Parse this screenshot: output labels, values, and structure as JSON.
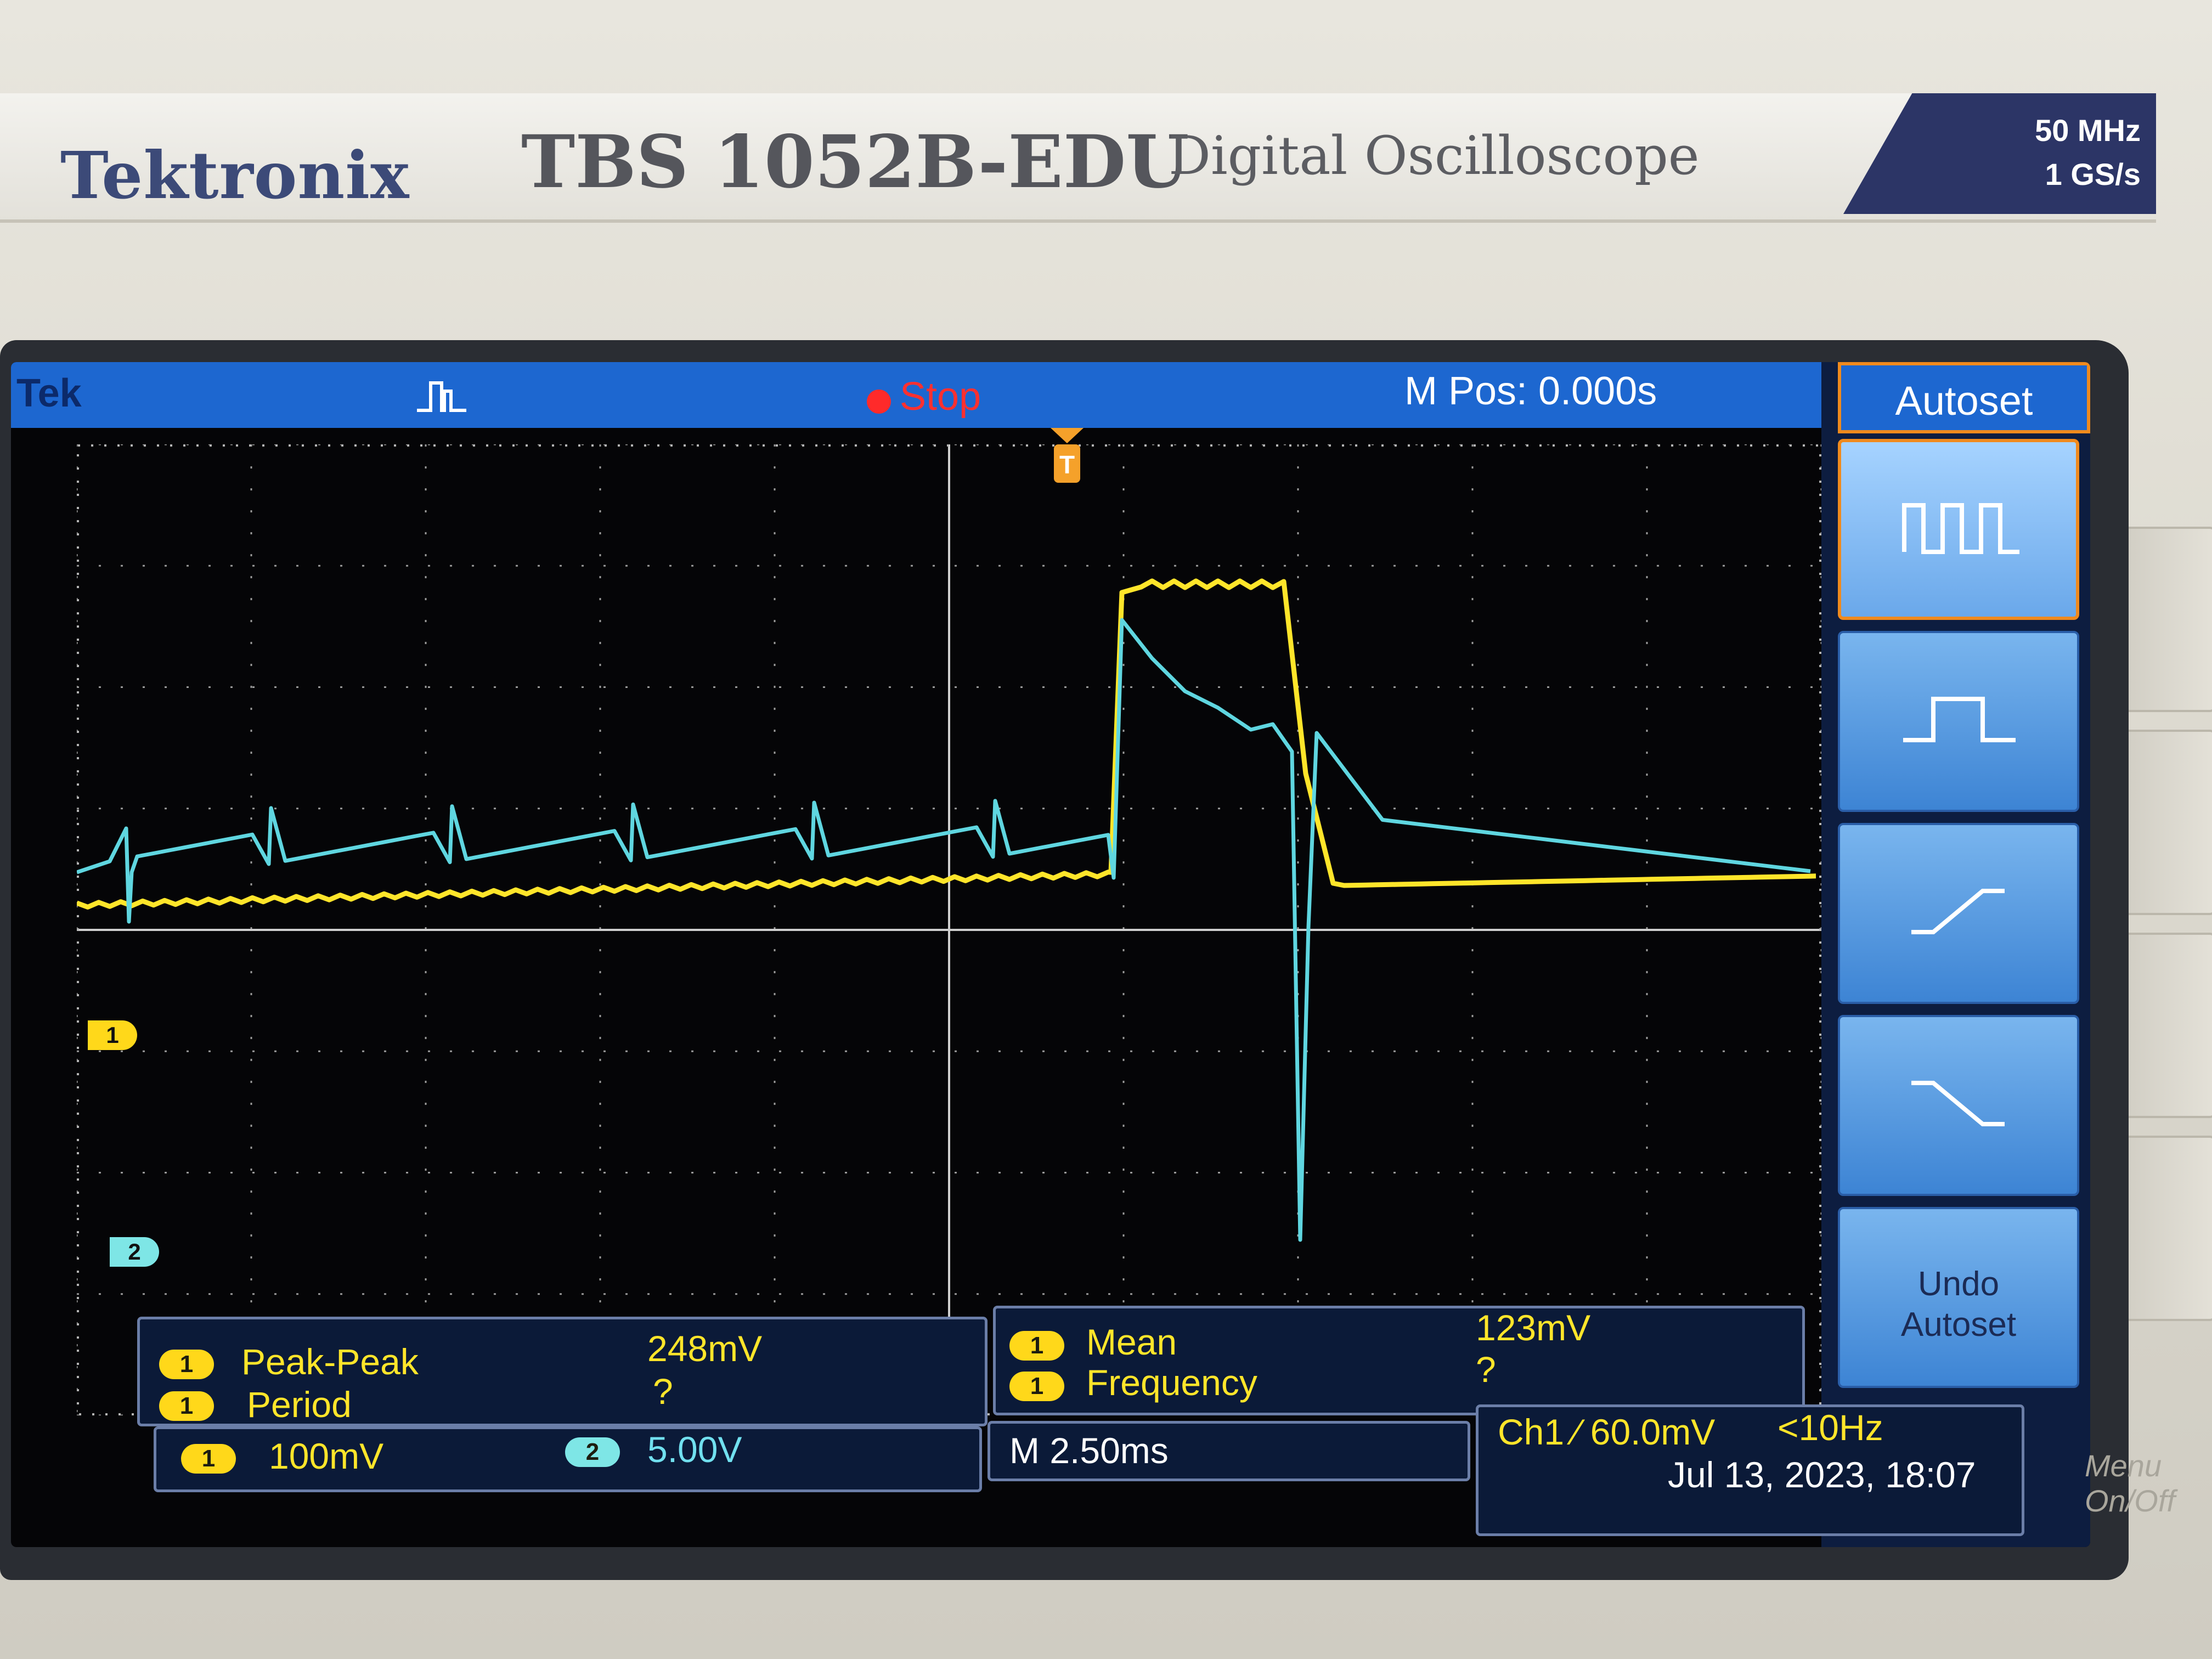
{
  "device": {
    "brand": "Tektronix",
    "model": "TBS 1052B-EDU",
    "subtitle": "Digital Oscilloscope",
    "spec_bandwidth": "50 MHz",
    "spec_sample_rate": "1 GS/s"
  },
  "topbar": {
    "tek": "Tek",
    "status": "Stop",
    "mpos": "M Pos: 0.000s"
  },
  "trigger_marker": "T",
  "channel_markers": {
    "ch1": "1",
    "ch2": "2"
  },
  "menu": {
    "title": "Autoset",
    "undo_line1": "Undo",
    "undo_line2": "Autoset"
  },
  "measurements": {
    "m1": {
      "ch": "1",
      "label": "Peak-Peak",
      "value": "248mV"
    },
    "m2": {
      "ch": "1",
      "label": "Period",
      "value": "?"
    },
    "m3": {
      "ch": "1",
      "label": "Mean",
      "value": "123mV"
    },
    "m4": {
      "ch": "1",
      "label": "Frequency",
      "value": "?"
    }
  },
  "status": {
    "ch1_ch": "1",
    "ch1_scale": "100mV",
    "ch2_ch": "2",
    "ch2_scale": "5.00V",
    "timebase": "M 2.50ms",
    "trigger": "Ch1 ⁄ 60.0mV",
    "trigger_freq": "<10Hz",
    "datetime": "Jul 13, 2023, 18:07"
  },
  "bezel": {
    "menu_onoff_line1": "Menu",
    "menu_onoff_line2": "On/Off"
  },
  "colors": {
    "ch1": "#ffe52a",
    "ch2": "#5fd6e0",
    "accent": "#1d67d0",
    "menu_highlight": "#f08a1d"
  },
  "icons": [
    "square-wave-icon",
    "single-pulse-icon",
    "rising-edge-icon",
    "falling-edge-icon"
  ]
}
